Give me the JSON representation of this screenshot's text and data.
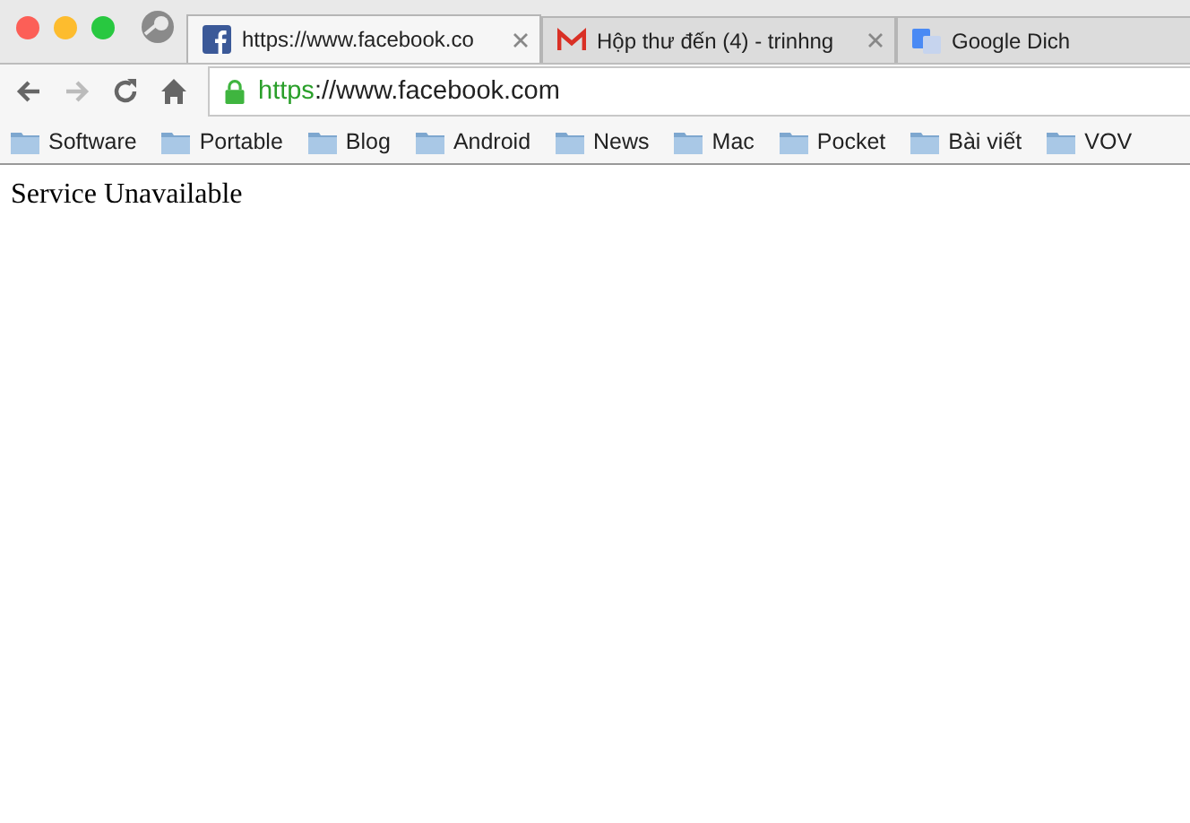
{
  "tabs": [
    {
      "title": "https://www.facebook.co",
      "kind": "facebook",
      "selected": true
    },
    {
      "title": "Hộp thư đến (4) - trinhng",
      "kind": "gmail",
      "selected": false
    },
    {
      "title": "Google Dich",
      "kind": "translate",
      "selected": false
    }
  ],
  "address": {
    "scheme": "https",
    "rest": "://www.facebook.com",
    "secure": true
  },
  "bookmarks": [
    "Software",
    "Portable",
    "Blog",
    "Android",
    "News",
    "Mac",
    "Pocket",
    "Bài viết",
    "VOV"
  ],
  "content": "Service Unavailable"
}
